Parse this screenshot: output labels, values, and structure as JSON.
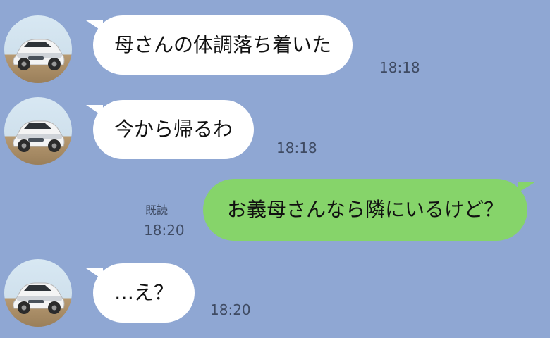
{
  "app": {
    "theme_bg": "#8fa7d3",
    "incoming_bubble_color": "#ffffff",
    "outgoing_bubble_color": "#86d46a"
  },
  "messages": [
    {
      "direction": "incoming",
      "avatar_icon": "car-avatar-icon",
      "text": "母さんの体調落ち着いた",
      "time": "18:18"
    },
    {
      "direction": "incoming",
      "avatar_icon": "car-avatar-icon",
      "text": "今から帰るわ",
      "time": "18:18"
    },
    {
      "direction": "outgoing",
      "text": "お義母さんなら隣にいるけど？",
      "read_status": "既読",
      "time": "18:20"
    },
    {
      "direction": "incoming",
      "avatar_icon": "car-avatar-icon",
      "text": "…え？",
      "time": "18:20"
    }
  ]
}
